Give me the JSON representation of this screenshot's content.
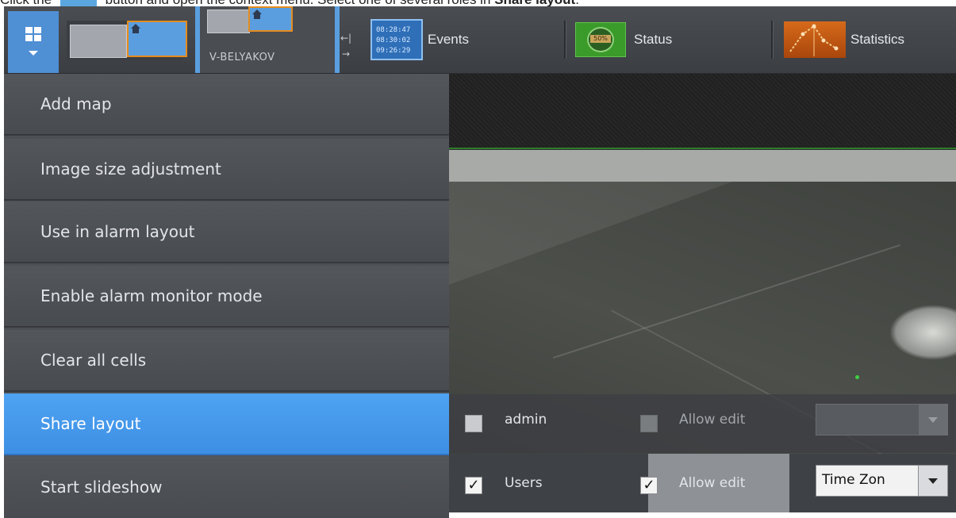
{
  "caption": {
    "prefix": "Click the",
    "middle": "button and open the context menu. Select one of several roles in",
    "bold": "Share layout",
    "suffix": "."
  },
  "toolbar": {
    "layouts_button_icon": "grid-icon",
    "layout2_label": "V-BELYAKOV",
    "events_label": "Events",
    "events_times": [
      "08:28:47",
      "08:30:02",
      "09:26:29"
    ],
    "status_label": "Status",
    "status_value": "50%",
    "statistics_label": "Statistics"
  },
  "menu": {
    "items": [
      {
        "label": "Add map"
      },
      {
        "label": "Image size adjustment"
      },
      {
        "label": "Use in alarm layout"
      },
      {
        "label": "Enable alarm monitor mode"
      },
      {
        "label": "Clear all cells"
      },
      {
        "label": "Share layout",
        "active": true
      },
      {
        "label": "Start slideshow"
      }
    ]
  },
  "share": {
    "rows": [
      {
        "role": "admin",
        "role_checked": false,
        "allow_edit_label": "Allow edit",
        "allow_edit_checked": false,
        "allow_edit_enabled": false,
        "timezone": ""
      },
      {
        "role": "Users",
        "role_checked": true,
        "allow_edit_label": "Allow edit",
        "allow_edit_checked": true,
        "allow_edit_enabled": true,
        "timezone": "Time Zon"
      }
    ]
  },
  "colors": {
    "accent_blue": "#4fa3f2",
    "menu_bg": "#4c4f54",
    "status_green": "#3a9a2a",
    "statistics_orange": "#d76a1a"
  }
}
